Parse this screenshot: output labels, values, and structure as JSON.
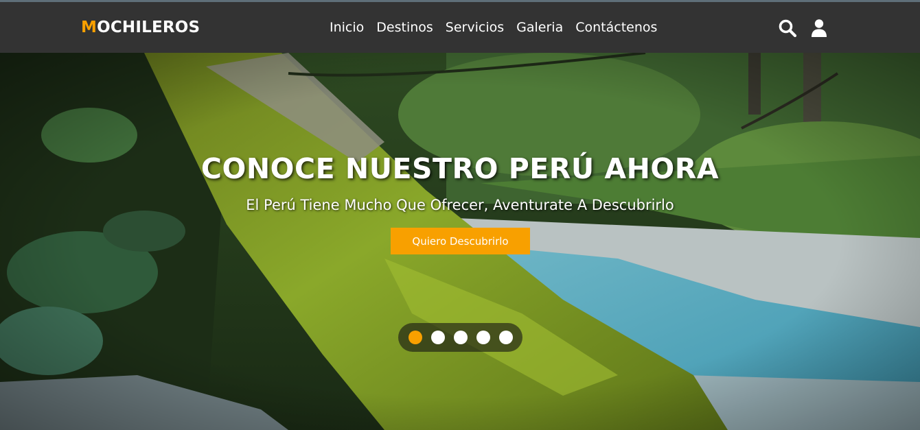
{
  "brand": {
    "first_letter": "M",
    "rest": "OCHILEROS",
    "accent_color": "#f8a000"
  },
  "nav": {
    "links": [
      {
        "label": "Inicio"
      },
      {
        "label": "Destinos"
      },
      {
        "label": "Servicios"
      },
      {
        "label": "Galeria"
      },
      {
        "label": "Contáctenos"
      }
    ],
    "icons": [
      "search-icon",
      "user-icon"
    ]
  },
  "hero": {
    "title": "CONOCE NUESTRO PERÚ AHORA",
    "subtitle": "El Perú Tiene Mucho Que Ofrecer, Aventurate A Descubrirlo",
    "cta_label": "Quiero Descubrirlo",
    "slides_count": 5,
    "active_slide": 1
  }
}
